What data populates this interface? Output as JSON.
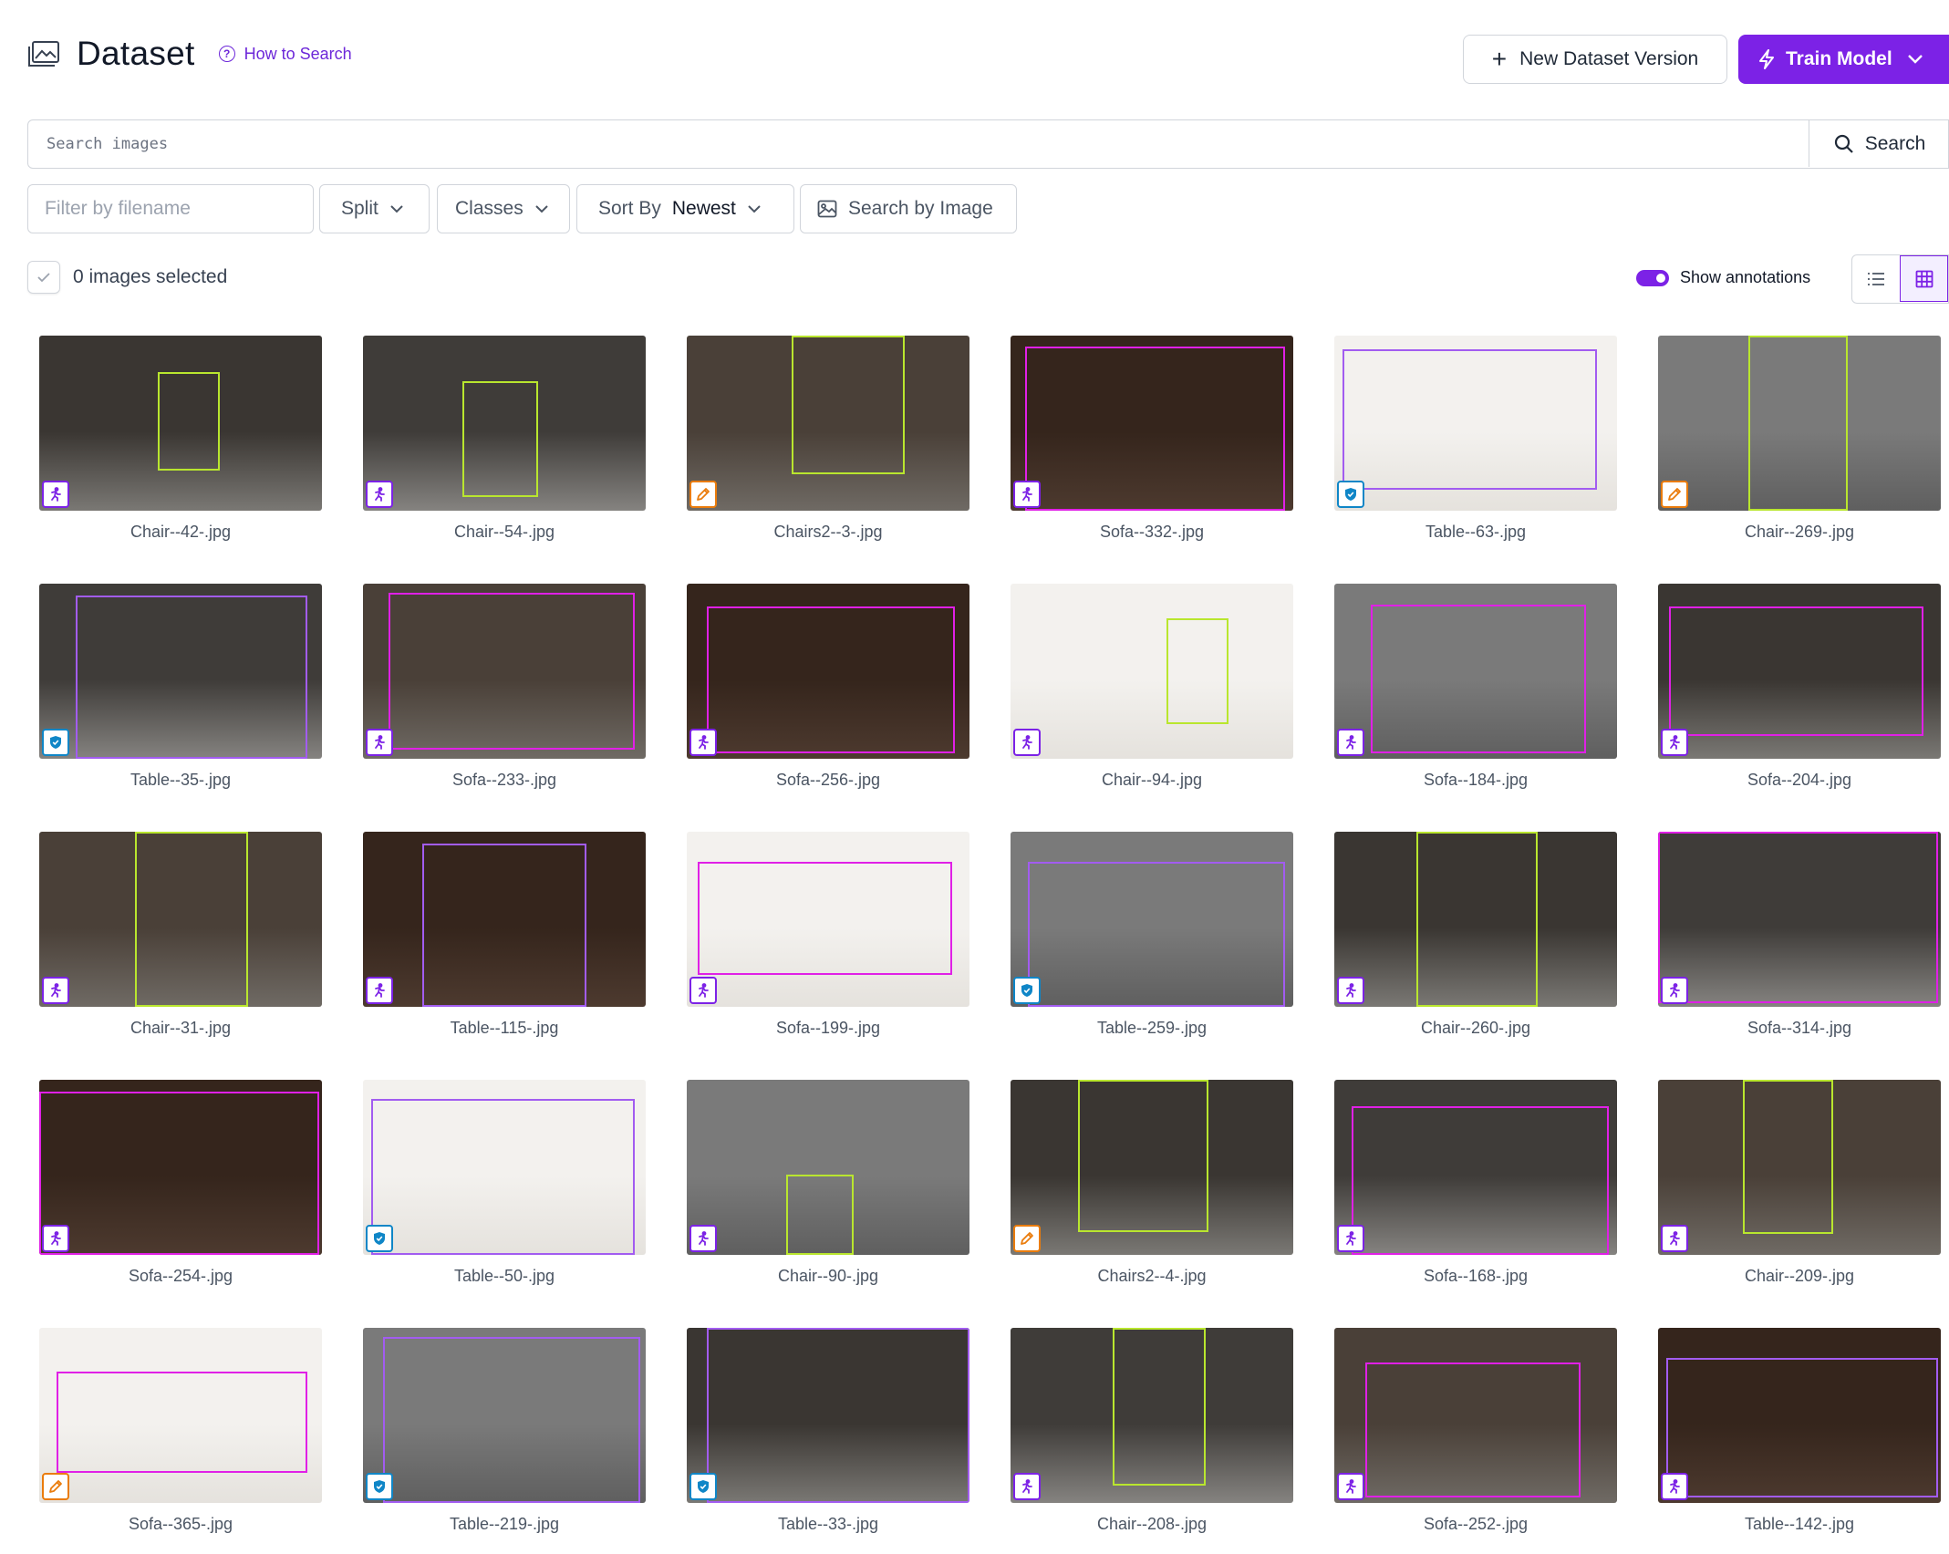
{
  "header": {
    "title": "Dataset",
    "how_to_search": "How to Search"
  },
  "actions": {
    "new_version": "New Dataset Version",
    "train_model": "Train Model"
  },
  "search": {
    "placeholder": "Search images",
    "button": "Search"
  },
  "filters": {
    "filename_placeholder": "Filter by filename",
    "split": "Split",
    "classes": "Classes",
    "sort_by": "Sort By",
    "sort_value": "Newest",
    "search_by_image": "Search by Image"
  },
  "selection": {
    "label": "0 images selected"
  },
  "annotations_toggle": {
    "label": "Show annotations",
    "on": true
  },
  "colors": {
    "accent": "#7c22e6",
    "chair_box": "#b9e62e",
    "sofa_box": "#e020e6",
    "table_box": "#a25cf0",
    "train_badge": "#7c22e6",
    "valid_badge": "#0f86c7",
    "test_badge": "#ea7c0c"
  },
  "images": [
    {
      "filename": "Chair--42-.jpg",
      "split": "train",
      "cls": "chair"
    },
    {
      "filename": "Chair--54-.jpg",
      "split": "train",
      "cls": "chair"
    },
    {
      "filename": "Chairs2--3-.jpg",
      "split": "test",
      "cls": "chair"
    },
    {
      "filename": "Sofa--332-.jpg",
      "split": "train",
      "cls": "sofa"
    },
    {
      "filename": "Table--63-.jpg",
      "split": "valid",
      "cls": "table"
    },
    {
      "filename": "Chair--269-.jpg",
      "split": "test",
      "cls": "chair"
    },
    {
      "filename": "Table--35-.jpg",
      "split": "valid",
      "cls": "table"
    },
    {
      "filename": "Sofa--233-.jpg",
      "split": "train",
      "cls": "sofa"
    },
    {
      "filename": "Sofa--256-.jpg",
      "split": "train",
      "cls": "sofa"
    },
    {
      "filename": "Chair--94-.jpg",
      "split": "train",
      "cls": "chair"
    },
    {
      "filename": "Sofa--184-.jpg",
      "split": "train",
      "cls": "sofa"
    },
    {
      "filename": "Sofa--204-.jpg",
      "split": "train",
      "cls": "sofa"
    },
    {
      "filename": "Chair--31-.jpg",
      "split": "train",
      "cls": "chair"
    },
    {
      "filename": "Table--115-.jpg",
      "split": "train",
      "cls": "table"
    },
    {
      "filename": "Sofa--199-.jpg",
      "split": "train",
      "cls": "sofa"
    },
    {
      "filename": "Table--259-.jpg",
      "split": "valid",
      "cls": "table"
    },
    {
      "filename": "Chair--260-.jpg",
      "split": "train",
      "cls": "chair"
    },
    {
      "filename": "Sofa--314-.jpg",
      "split": "train",
      "cls": "sofa"
    },
    {
      "filename": "Sofa--254-.jpg",
      "split": "train",
      "cls": "sofa"
    },
    {
      "filename": "Table--50-.jpg",
      "split": "valid",
      "cls": "table"
    },
    {
      "filename": "Chair--90-.jpg",
      "split": "train",
      "cls": "chair"
    },
    {
      "filename": "Chairs2--4-.jpg",
      "split": "test",
      "cls": "chair"
    },
    {
      "filename": "Sofa--168-.jpg",
      "split": "train",
      "cls": "sofa"
    },
    {
      "filename": "Chair--209-.jpg",
      "split": "train",
      "cls": "chair"
    },
    {
      "filename": "Sofa--365-.jpg",
      "split": "test",
      "cls": "sofa"
    },
    {
      "filename": "Table--219-.jpg",
      "split": "valid",
      "cls": "table"
    },
    {
      "filename": "Table--33-.jpg",
      "split": "valid",
      "cls": "table"
    },
    {
      "filename": "Chair--208-.jpg",
      "split": "train",
      "cls": "chair"
    },
    {
      "filename": "Sofa--252-.jpg",
      "split": "train",
      "cls": "sofa"
    },
    {
      "filename": "Table--142-.jpg",
      "split": "train",
      "cls": "table"
    }
  ]
}
